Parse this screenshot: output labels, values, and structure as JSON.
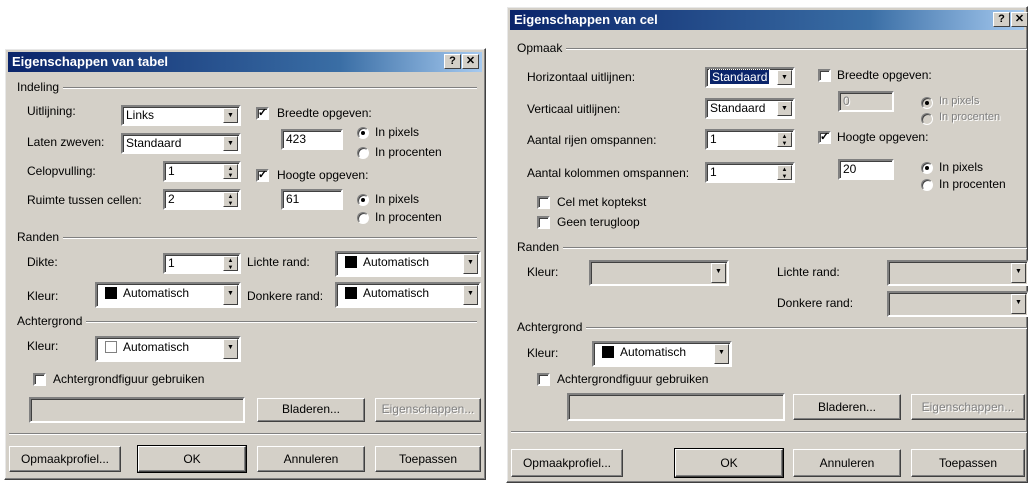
{
  "left": {
    "title": "Eigenschappen van tabel",
    "help": "?",
    "close": "✕",
    "indeling": {
      "legend": "Indeling",
      "uitlijning_label": "Uitlijning:",
      "uitlijning_value": "Links",
      "laten_zweven_label": "Laten zweven:",
      "laten_zweven_value": "Standaard",
      "celopvulling_label": "Celopvulling:",
      "celopvulling_value": "1",
      "ruimte_label": "Ruimte tussen cellen:",
      "ruimte_value": "2",
      "breedte_label": "Breedte opgeven:",
      "breedte_value": "423",
      "breedte_pixels": "In pixels",
      "breedte_procenten": "In procenten",
      "hoogte_label": "Hoogte opgeven:",
      "hoogte_value": "61",
      "hoogte_pixels": "In pixels",
      "hoogte_procenten": "In procenten"
    },
    "randen": {
      "legend": "Randen",
      "dikte_label": "Dikte:",
      "dikte_value": "1",
      "lichte_label": "Lichte rand:",
      "lichte_value": "Automatisch",
      "kleur_label": "Kleur:",
      "kleur_value": "Automatisch",
      "donkere_label": "Donkere rand:",
      "donkere_value": "Automatisch"
    },
    "achtergrond": {
      "legend": "Achtergrond",
      "kleur_label": "Kleur:",
      "kleur_value": "Automatisch",
      "figuur_label": "Achtergrondfiguur gebruiken",
      "bladeren": "Bladeren...",
      "eigenschappen": "Eigenschappen..."
    },
    "buttons": {
      "profiel": "Opmaakprofiel...",
      "ok": "OK",
      "annuleren": "Annuleren",
      "toepassen": "Toepassen"
    }
  },
  "right": {
    "title": "Eigenschappen van cel",
    "help": "?",
    "close": "✕",
    "opmaak": {
      "legend": "Opmaak",
      "horizontaal_label": "Horizontaal uitlijnen:",
      "horizontaal_value": "Standaard",
      "verticaal_label": "Verticaal uitlijnen:",
      "verticaal_value": "Standaard",
      "rijen_label": "Aantal rijen omspannen:",
      "rijen_value": "1",
      "kolommen_label": "Aantal kolommen omspannen:",
      "kolommen_value": "1",
      "breedte_label": "Breedte opgeven:",
      "breedte_value": "0",
      "breedte_pixels": "In pixels",
      "breedte_procenten": "In procenten",
      "hoogte_label": "Hoogte opgeven:",
      "hoogte_value": "20",
      "hoogte_pixels": "In pixels",
      "hoogte_procenten": "In procenten",
      "koptekst_label": "Cel met koptekst",
      "terugloop_label": "Geen terugloop"
    },
    "randen": {
      "legend": "Randen",
      "kleur_label": "Kleur:",
      "lichte_label": "Lichte rand:",
      "donkere_label": "Donkere rand:"
    },
    "achtergrond": {
      "legend": "Achtergrond",
      "kleur_label": "Kleur:",
      "kleur_value": "Automatisch",
      "figuur_label": "Achtergrondfiguur gebruiken",
      "bladeren": "Bladeren...",
      "eigenschappen": "Eigenschappen..."
    },
    "buttons": {
      "profiel": "Opmaakprofiel...",
      "ok": "OK",
      "annuleren": "Annuleren",
      "toepassen": "Toepassen"
    }
  },
  "colors": {
    "titlebar": "#0a246a",
    "dialog": "#d4d0c8",
    "swatch_black": "#000000",
    "swatch_white": "#ffffff"
  }
}
